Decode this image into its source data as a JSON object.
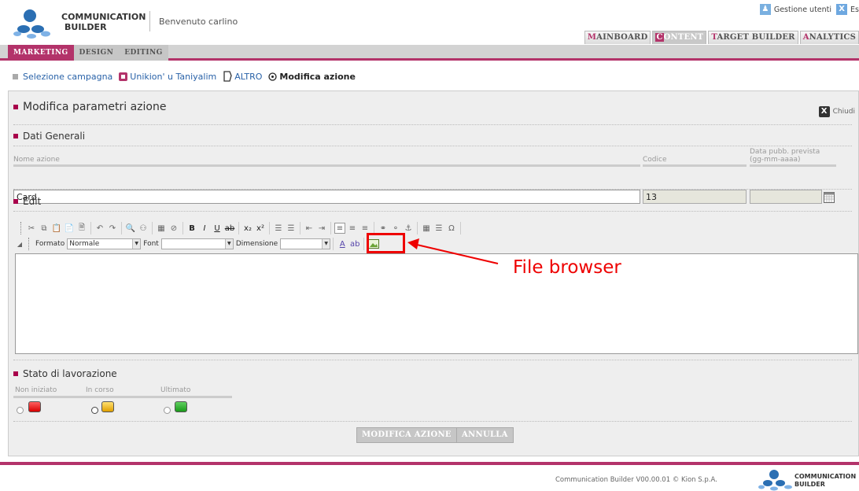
{
  "app": {
    "brand_line1": "COMMUNICATION",
    "brand_line2": "BUILDER",
    "welcome": "Benvenuto carlino"
  },
  "top_links": {
    "users": "Gestione utenti",
    "exit": "Es"
  },
  "main_tabs": [
    {
      "first": "M",
      "rest": "AINBOARD",
      "active": false
    },
    {
      "first": "C",
      "rest": "ONTENT",
      "active": true
    },
    {
      "first": "T",
      "rest": "ARGET BUILDER",
      "active": false
    },
    {
      "first": "A",
      "rest": "NALYTICS",
      "active": false
    }
  ],
  "sub_tabs": [
    {
      "label": "MARKETING",
      "active": true
    },
    {
      "label": "DESIGN",
      "active": false
    },
    {
      "label": "EDITING",
      "active": false
    }
  ],
  "breadcrumb": {
    "item1": "Selezione campagna",
    "item2": "Unikion' u Taniyalim",
    "item3": "ALTRO",
    "item4": "Modifica azione"
  },
  "panel": {
    "title": "Modifica parametri azione",
    "close": "Chiudi"
  },
  "general": {
    "title": "Dati Generali",
    "name_label": "Nome azione",
    "name_value": "Card",
    "code_label": "Codice",
    "code_value": "13",
    "date_label_line1": "Data pubb. prevista",
    "date_label_line2": "(gg-mm-aaaa)",
    "date_value": ""
  },
  "edit": {
    "title": "Edit",
    "format_label": "Formato",
    "format_value": "Normale",
    "font_label": "Font",
    "font_value": "",
    "size_label": "Dimensione",
    "size_value": ""
  },
  "annotation": {
    "label": "File browser"
  },
  "status": {
    "title": "Stato di lavorazione",
    "options": [
      "Non iniziato",
      "In corso",
      "Ultimato"
    ],
    "selected": "In corso",
    "colors": {
      "red": "#e00000",
      "yellow": "#f0b400",
      "green": "#2aa82a"
    }
  },
  "actions": {
    "submit": "MODIFICA AZIONE",
    "cancel": "ANNULLA"
  },
  "footer": {
    "text": "Communication Builder V00.00.01 © Kion S.p.A.",
    "brand_line1": "COMMUNICATION",
    "brand_line2": "BUILDER"
  },
  "colors": {
    "accent": "#b3336a",
    "link": "#2962a8",
    "annotation": "#e00000"
  }
}
